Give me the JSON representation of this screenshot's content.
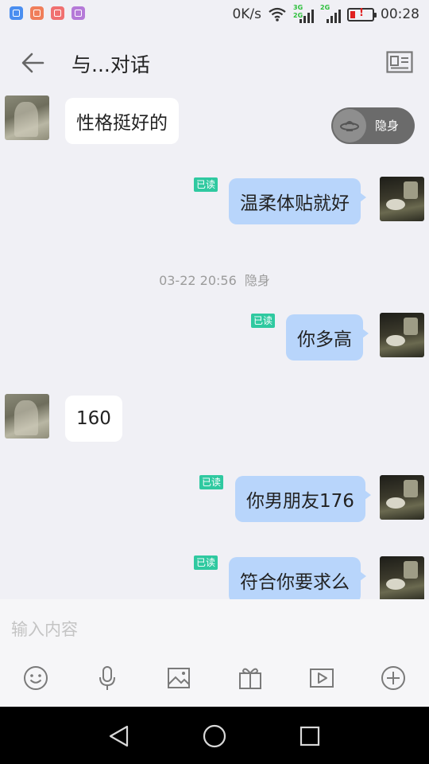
{
  "status_bar": {
    "apps": [
      {
        "icon": "shield-app-icon",
        "color": "#4a8ef0"
      },
      {
        "icon": "mail-app-icon",
        "color": "#f07e5a"
      },
      {
        "icon": "clipboard-app-icon",
        "color": "#f07070"
      },
      {
        "icon": "gallery-app-icon",
        "color": "#b57ad8"
      }
    ],
    "net_speed": "0K/s",
    "net_tag_1": "3G",
    "net_tag_2": "2G",
    "net_tag_3": "2G",
    "time": "00:28"
  },
  "header": {
    "title": "与...对话",
    "back_icon": "arrow-left-icon",
    "profile_icon": "profile-card-icon"
  },
  "invisible_toggle": {
    "label": "隐身",
    "icon": "ufo-icon"
  },
  "read_label": "已读",
  "messages": [
    {
      "side": "in",
      "text": "性格挺好的"
    },
    {
      "side": "out",
      "text": "温柔体贴就好",
      "read": true
    },
    {
      "side": "out",
      "text": "你多高",
      "read": true
    },
    {
      "side": "in",
      "text": "160"
    },
    {
      "side": "out",
      "text": "你男朋友176",
      "read": true
    },
    {
      "side": "out",
      "text": "符合你要求么",
      "read": true
    }
  ],
  "timestamp": {
    "time": "03-22 20:56",
    "status": "隐身"
  },
  "input": {
    "placeholder": "输入内容",
    "value": ""
  },
  "toolbar": [
    "emoji-icon",
    "microphone-icon",
    "image-icon",
    "gift-icon",
    "video-icon",
    "plus-circle-icon"
  ],
  "nav": [
    "back-triangle-icon",
    "home-circle-icon",
    "recents-square-icon"
  ],
  "colors": {
    "background": "#f0f0f5",
    "incoming_bubble": "#ffffff",
    "outgoing_bubble": "#b8d5fb",
    "read_badge": "#2fc9a0",
    "toggle": "#6b6b6b"
  }
}
